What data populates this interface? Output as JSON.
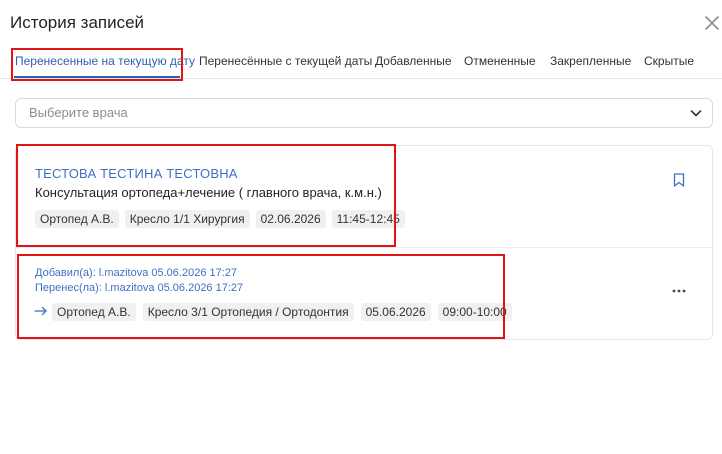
{
  "modal": {
    "title": "История записей"
  },
  "tabs": [
    {
      "label": "Перенесенные на текущую дату",
      "active": true
    },
    {
      "label": "Перенесённые с текущей даты",
      "active": false
    },
    {
      "label": "Добавленные",
      "active": false
    },
    {
      "label": "Отмененные",
      "active": false
    },
    {
      "label": "Закрепленные",
      "active": false
    },
    {
      "label": "Скрытые",
      "active": false
    }
  ],
  "doctor_select": {
    "placeholder": "Выберите врача"
  },
  "record": {
    "patient": "ТЕСТОВА ТЕСТИНА ТЕСТОВНА",
    "service": "Консультация ортопеда+лечение ( главного врача, к.м.н.)",
    "current": {
      "doctor": "Ортопед А.В.",
      "chair": "Кресло 1/1 Хирургия",
      "date": "02.06.2026",
      "time": "11:45-12:45"
    },
    "history": {
      "added": "Добавил(а): l.mazitova 05.06.2026 17:27",
      "moved": "Перенес(ла): l.mazitova 05.06.2026 17:27",
      "previous": {
        "doctor": "Ортопед А.В.",
        "chair": "Кресло 3/1 Ортопедия / Ортодонтия",
        "date": "05.06.2026",
        "time": "09:00-10:00"
      }
    }
  },
  "icons": {
    "close": "close-icon",
    "chevron": "chevron-down-icon",
    "bookmark": "bookmark-icon",
    "arrow": "arrow-right-icon",
    "more": "more-horizontal-icon"
  },
  "colors": {
    "accent": "#2d5fb4",
    "link": "#3f6fc4",
    "highlight": "#e01414"
  }
}
